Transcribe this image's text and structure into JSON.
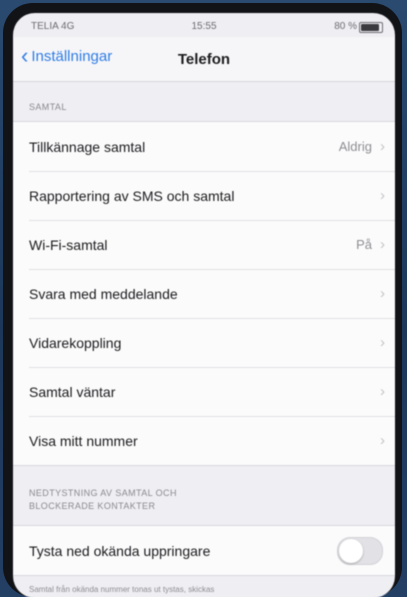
{
  "status_bar": {
    "carrier": "TELIA 4G",
    "time": "15:55",
    "battery_pct": "80 %",
    "battery_level": 0.8
  },
  "nav": {
    "back_label": "Inställningar",
    "title": "Telefon"
  },
  "calls_section": {
    "header": "SAMTAL",
    "rows": [
      {
        "label": "Tillkännage samtal",
        "value": "Aldrig"
      },
      {
        "label": "Rapportering av SMS och samtal",
        "value": ""
      },
      {
        "label": "Wi-Fi-samtal",
        "value": "På"
      },
      {
        "label": "Svara med meddelande",
        "value": ""
      },
      {
        "label": "Vidarekoppling",
        "value": ""
      },
      {
        "label": "Samtal väntar",
        "value": ""
      },
      {
        "label": "Visa mitt nummer",
        "value": ""
      }
    ]
  },
  "blocking_section": {
    "header_line1": "NEDTYSTNING AV SAMTAL OCH",
    "header_line2": "BLOCKERADE KONTAKTER",
    "silence_unknown": {
      "label": "Tysta ned okända uppringare",
      "enabled": false
    },
    "footer": "Samtal från okända nummer tonas ut tystas, skickas"
  }
}
